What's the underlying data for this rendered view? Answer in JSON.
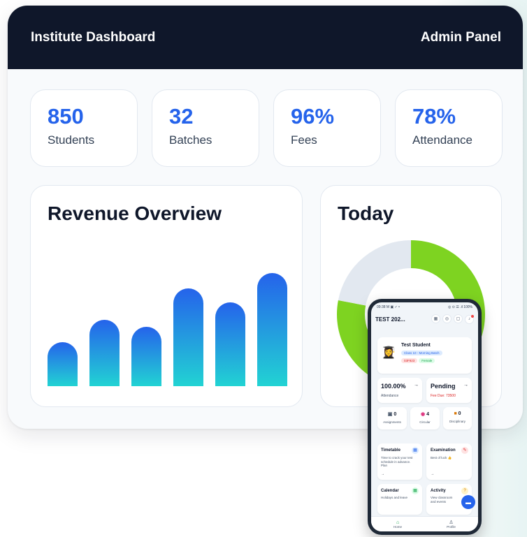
{
  "header": {
    "title": "Institute Dashboard",
    "right_label": "Admin Panel"
  },
  "stats": [
    {
      "value": "850",
      "label": "Students"
    },
    {
      "value": "32",
      "label": "Batches"
    },
    {
      "value": "96%",
      "label": "Fees"
    },
    {
      "value": "78%",
      "label": "Attendance"
    }
  ],
  "revenue": {
    "title": "Revenue Overview"
  },
  "today": {
    "title": "Today"
  },
  "chart_data": [
    {
      "type": "bar",
      "title": "Revenue Overview",
      "categories": [
        "",
        "",
        "",
        "",
        "",
        ""
      ],
      "values": [
        38,
        57,
        51,
        84,
        72,
        97
      ],
      "ylim": [
        0,
        100
      ]
    },
    {
      "type": "pie",
      "title": "Today",
      "values": [
        78,
        22
      ],
      "colors": [
        "#7ed321",
        "#e2e8f0"
      ]
    }
  ],
  "phone": {
    "status_left": "09:38 M ▣ ✓ •",
    "status_right": "◎ ⊙ ☰ .il 100%",
    "title": "TEST 202...",
    "profile": {
      "name": "Test Student",
      "class_chip": "Class 10 - Morning Batch",
      "id_chip": "03F923",
      "gender_chip": "Female"
    },
    "attendance": {
      "value": "100.00%",
      "label": "Attendance"
    },
    "pending": {
      "value": "Pending",
      "label": "Fee Due: 73500"
    },
    "counts": [
      {
        "value": "0",
        "label": "Assignments"
      },
      {
        "value": "4",
        "label": "Circular"
      },
      {
        "value": "0",
        "label": "Disciplinary"
      }
    ],
    "timetable": {
      "title": "Timetable",
      "desc": "Time to crack your test schedule in advance. Plan"
    },
    "examination": {
      "title": "Examination",
      "desc": "Best of luck 👍"
    },
    "calendar": {
      "title": "Calendar",
      "desc": "Holidays and leave"
    },
    "activity": {
      "title": "Activity",
      "desc": "View classroom and events"
    },
    "nav": [
      {
        "label": "Home"
      },
      {
        "label": "Profile"
      }
    ],
    "colors": {
      "accent": "#2563eb",
      "green": "#16a34a"
    }
  }
}
